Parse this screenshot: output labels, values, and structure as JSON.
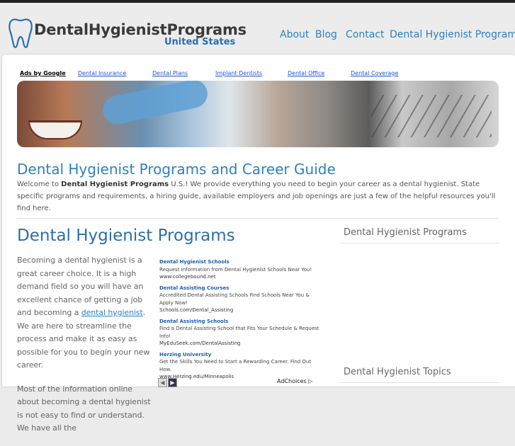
{
  "header": {
    "logo_title": "DentalHygienistPrograms",
    "logo_subtitle": "United States",
    "nav": [
      "About",
      "Blog",
      "Contact",
      "Dental Hygienist Programs"
    ]
  },
  "adbar": {
    "label": "Ads by Google",
    "links": [
      "Dental Insurance",
      "Dental Plans",
      "Implant Dentists",
      "Dental Office",
      "Dental Coverage"
    ]
  },
  "intro": {
    "heading": "Dental Hygienist Programs and Career Guide",
    "text_before": "Welcome to ",
    "brand": "Dental Hygienist Programs",
    "text_after": " U.S.! We provide everything you need to begin your career as a dental hygienist. State specific programs and requirements, a hiring guide, available employers and job openings are just a few of the helpful resources you'll find here."
  },
  "main": {
    "heading": "Dental Hygienist Programs",
    "p1_before": "Becoming a dental hygienist is a great career choice. It is a high demand field so you will have an excellent chance of getting a job and becoming a ",
    "p1_link": "dental hygienist",
    "p1_after": ". We are here to streamline the process and make it as easy as possible for you to begin your new career.",
    "p2": "Most of the information online about becoming a dental hygienist is not easy to find or understand. We have all the"
  },
  "ads": [
    {
      "title": "Dental Hygienist Schools",
      "desc": "Request Information from Dental Hygienist Schools Near You!",
      "url": "www.collegebound.net"
    },
    {
      "title": "Dental Assisting Courses",
      "desc": "Accredited Dental Assisting Schools Find Schools Near You & Apply Now!",
      "url": "Schools.com/Dental_Assisting"
    },
    {
      "title": "Dental Assisting Schools",
      "desc": "Find a Dental Assisting School that Fits Your Schedule & Request Info!",
      "url": "MyEduSeek.com/DentalAssisting"
    },
    {
      "title": "Herzing University",
      "desc": "Get the Skills You Need to Start a Rewarding Career. Find Out How.",
      "url": "www.Herzing.edu/Minneapolis"
    }
  ],
  "adchoices": "AdChoices",
  "sidebar": {
    "heading1": "Dental Hygienist Programs",
    "heading2": "Dental Hygienist Topics"
  },
  "colors": {
    "accent": "#2f7fbf",
    "logo_text": "#3a3a3a"
  }
}
